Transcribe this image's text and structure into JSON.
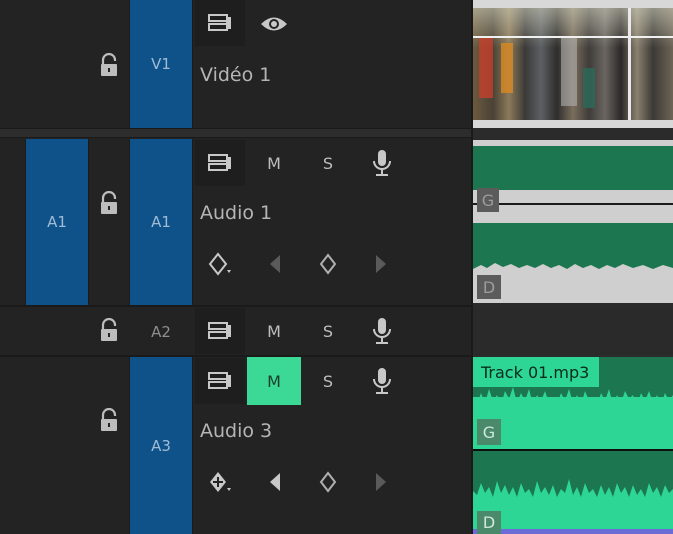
{
  "tracks": {
    "v1": {
      "label": "V1",
      "name": "Vidéo 1"
    },
    "a1": {
      "source_label": "A1",
      "label": "A1",
      "name": "Audio 1"
    },
    "a2": {
      "label": "A2"
    },
    "a3": {
      "label": "A3",
      "name": "Audio 3"
    }
  },
  "buttons": {
    "mute": "M",
    "solo": "S"
  },
  "clips": {
    "audio1": {
      "left_channel": "G",
      "right_channel": "D"
    },
    "audio3": {
      "title": "Track 01.mp3",
      "left_channel": "G",
      "right_channel": "D"
    }
  },
  "colors": {
    "track_target": "#0e5289",
    "audio_clip_dark": "#1c7650",
    "audio_clip_bright": "#2ed696",
    "mute_active": "#3cd896"
  }
}
